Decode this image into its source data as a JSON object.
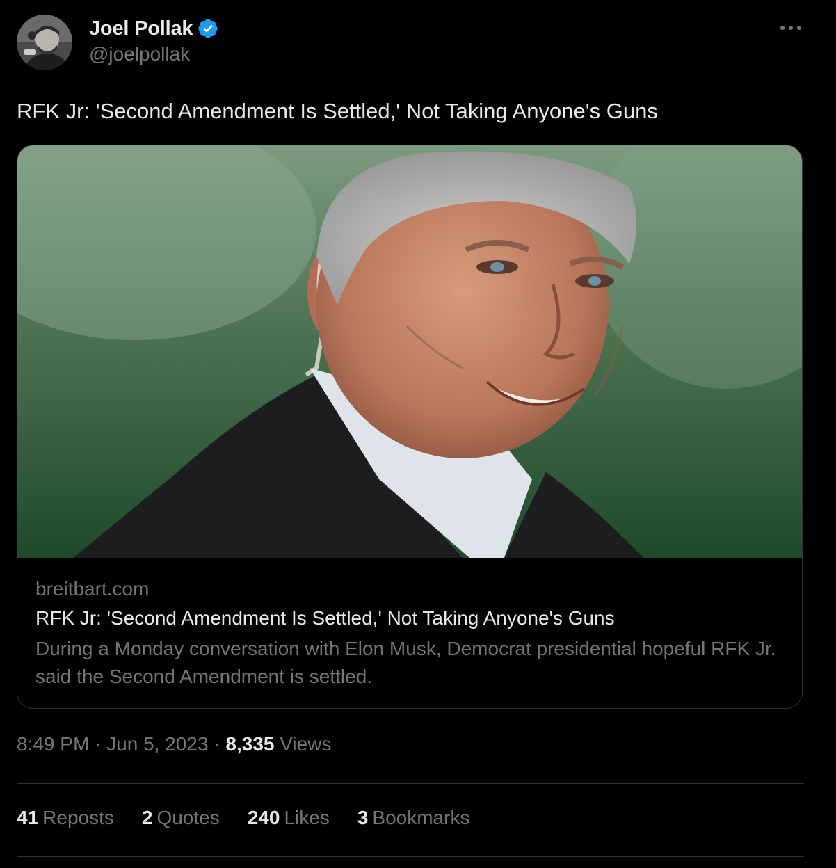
{
  "author": {
    "display_name": "Joel Pollak",
    "handle": "@joelpollak",
    "verified": true
  },
  "tweet": {
    "text": "RFK Jr: 'Second Amendment Is Settled,' Not Taking Anyone's Guns"
  },
  "card": {
    "domain": "breitbart.com",
    "title": "RFK Jr: 'Second Amendment Is Settled,' Not Taking Anyone's Guns",
    "description": "During a Monday conversation with Elon Musk, Democrat presidential hopeful RFK Jr. said the Second Amendment is settled."
  },
  "meta": {
    "time": "8:49 PM",
    "separator": " · ",
    "date": "Jun 5, 2023",
    "views_count": "8,335",
    "views_label": "Views"
  },
  "stats": {
    "reposts": {
      "count": "41",
      "label": "Reposts"
    },
    "quotes": {
      "count": "2",
      "label": "Quotes"
    },
    "likes": {
      "count": "240",
      "label": "Likes"
    },
    "bookmarks": {
      "count": "3",
      "label": "Bookmarks"
    }
  },
  "colors": {
    "background": "#000000",
    "text_primary": "#e7e9ea",
    "text_secondary": "#71767b",
    "border": "#2f3336",
    "verified_badge": "#1d9bf0"
  },
  "icons": {
    "more": "more-horizontal-icon",
    "verified": "verified-badge-icon"
  }
}
